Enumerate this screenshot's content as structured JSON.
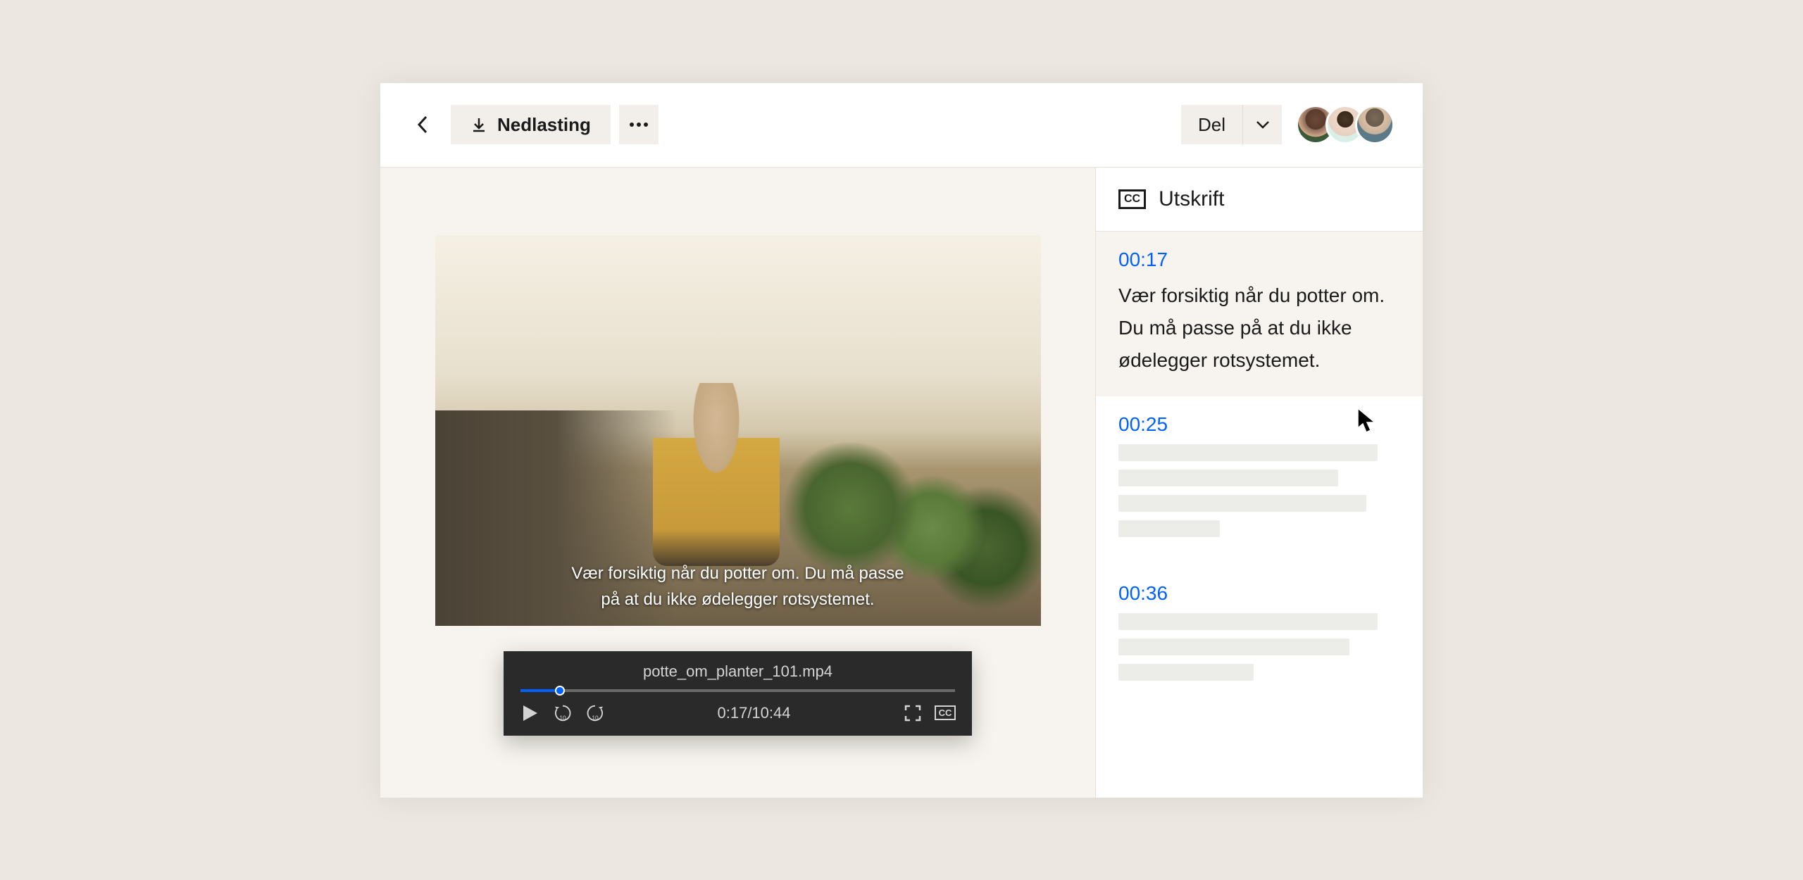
{
  "toolbar": {
    "download_label": "Nedlasting",
    "share_label": "Del"
  },
  "video": {
    "filename": "potte_om_planter_101.mp4",
    "caption_line1": "Vær forsiktig når du potter om. Du må passe",
    "caption_line2": "på at du ikke ødelegger rotsystemet.",
    "current_time": "0:17",
    "duration": "10:44",
    "time_display": "0:17/10:44"
  },
  "transcript": {
    "title": "Utskrift",
    "entries": [
      {
        "ts": "00:17",
        "text": "Vær forsiktig når du potter om. Du må passe på at du ikke ødelegger rotsystemet."
      },
      {
        "ts": "00:25",
        "text": ""
      },
      {
        "ts": "00:36",
        "text": ""
      }
    ]
  },
  "colors": {
    "accent": "#0061fe",
    "toolbar_bg": "#f2efea",
    "page_bg": "#ece8e1"
  }
}
